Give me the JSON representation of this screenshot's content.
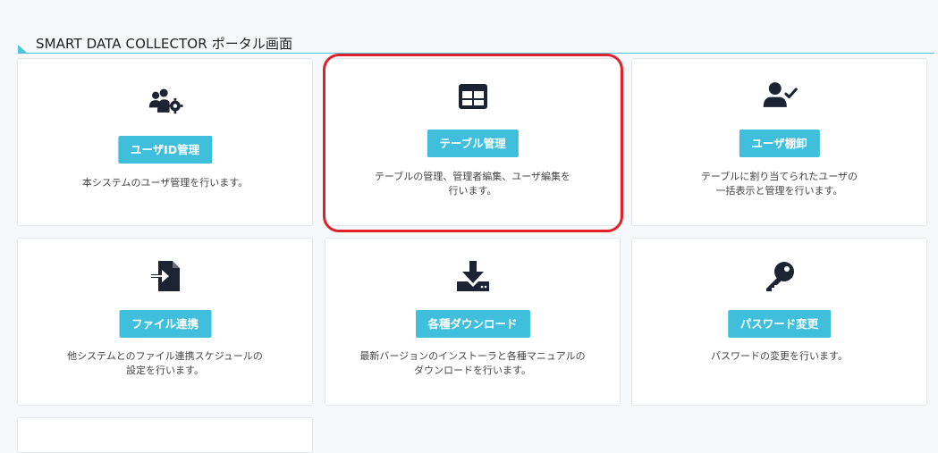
{
  "header": {
    "title": "SMART DATA COLLECTOR ポータル画面"
  },
  "cards": [
    {
      "button": "ユーザID管理",
      "description": "本システムのユーザ管理を行います。"
    },
    {
      "button": "テーブル管理",
      "description": "テーブルの管理、管理者編集、ユーザ編集を\n行います。"
    },
    {
      "button": "ユーザ棚卸",
      "description": "テーブルに割り当てられたユーザの\n一括表示と管理を行います。"
    },
    {
      "button": "ファイル連携",
      "description": "他システムとのファイル連携スケジュールの\n設定を行います。"
    },
    {
      "button": "各種ダウンロード",
      "description": "最新バージョンのインストーラと各種マニュアルの\nダウンロードを行います。"
    },
    {
      "button": "パスワード変更",
      "description": "パスワードの変更を行います。"
    }
  ],
  "colors": {
    "accent": "#3fbfdc",
    "highlight": "#e0202a",
    "icon": "#1c2433"
  }
}
